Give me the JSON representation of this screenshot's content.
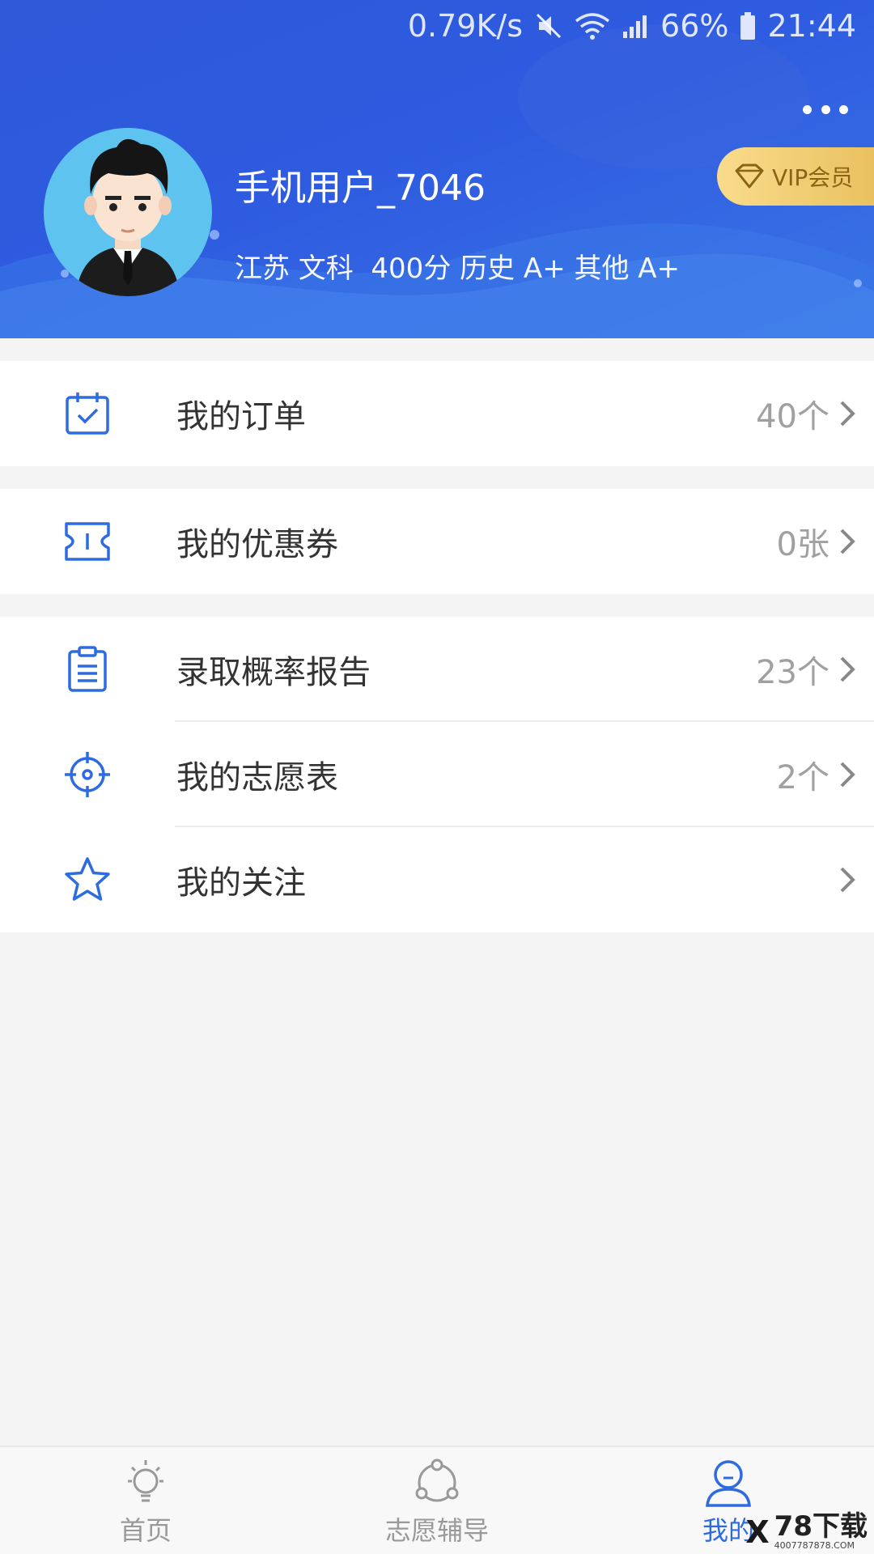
{
  "status_bar": {
    "speed": "0.79K/s",
    "battery": "66%",
    "time": "21:44"
  },
  "profile": {
    "username": "手机用户_7046",
    "info": "江苏 文科  400分 历史 A+ 其他 A+",
    "vip_label": "VIP会员"
  },
  "menu": {
    "orders": {
      "label": "我的订单",
      "value": "40个"
    },
    "coupons": {
      "label": "我的优惠券",
      "value": "0张"
    },
    "reports": {
      "label": "录取概率报告",
      "value": "23个"
    },
    "volunteer_forms": {
      "label": "我的志愿表",
      "value": "2个"
    },
    "follows": {
      "label": "我的关注",
      "value": ""
    }
  },
  "tabbar": {
    "home": "首页",
    "guidance": "志愿辅导",
    "mine": "我的"
  },
  "watermark": {
    "brand": "78下载",
    "site": "4007787878.COM"
  },
  "colors": {
    "header_blue": "#2f58d8",
    "accent": "#2f6be0",
    "vip_gold": "#e9c05e"
  }
}
